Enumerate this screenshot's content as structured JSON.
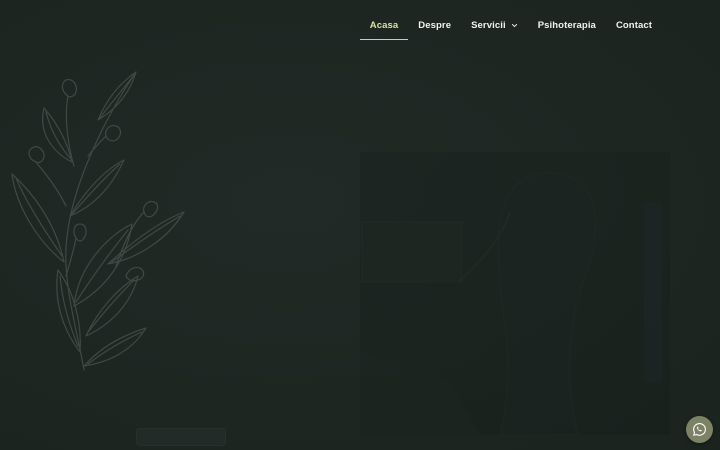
{
  "nav": {
    "items": [
      {
        "label": "Acasa",
        "active": true,
        "has_dropdown": false
      },
      {
        "label": "Despre",
        "active": false,
        "has_dropdown": false
      },
      {
        "label": "Servicii",
        "active": false,
        "has_dropdown": true
      },
      {
        "label": "Psihoterapia",
        "active": false,
        "has_dropdown": false
      },
      {
        "label": "Contact",
        "active": false,
        "has_dropdown": false
      }
    ],
    "dropdown_icon": "chevron-down-icon"
  },
  "decor": {
    "branch_icon": "leaf-branch-illustration"
  },
  "floating": {
    "chat_icon": "whatsapp-icon"
  },
  "colors": {
    "background": "#1f2723",
    "active_link": "#d8e2a0",
    "link": "#f1f3ef",
    "branch_stroke": "#3f4a44",
    "whatsapp_bg": "#7c8263"
  }
}
